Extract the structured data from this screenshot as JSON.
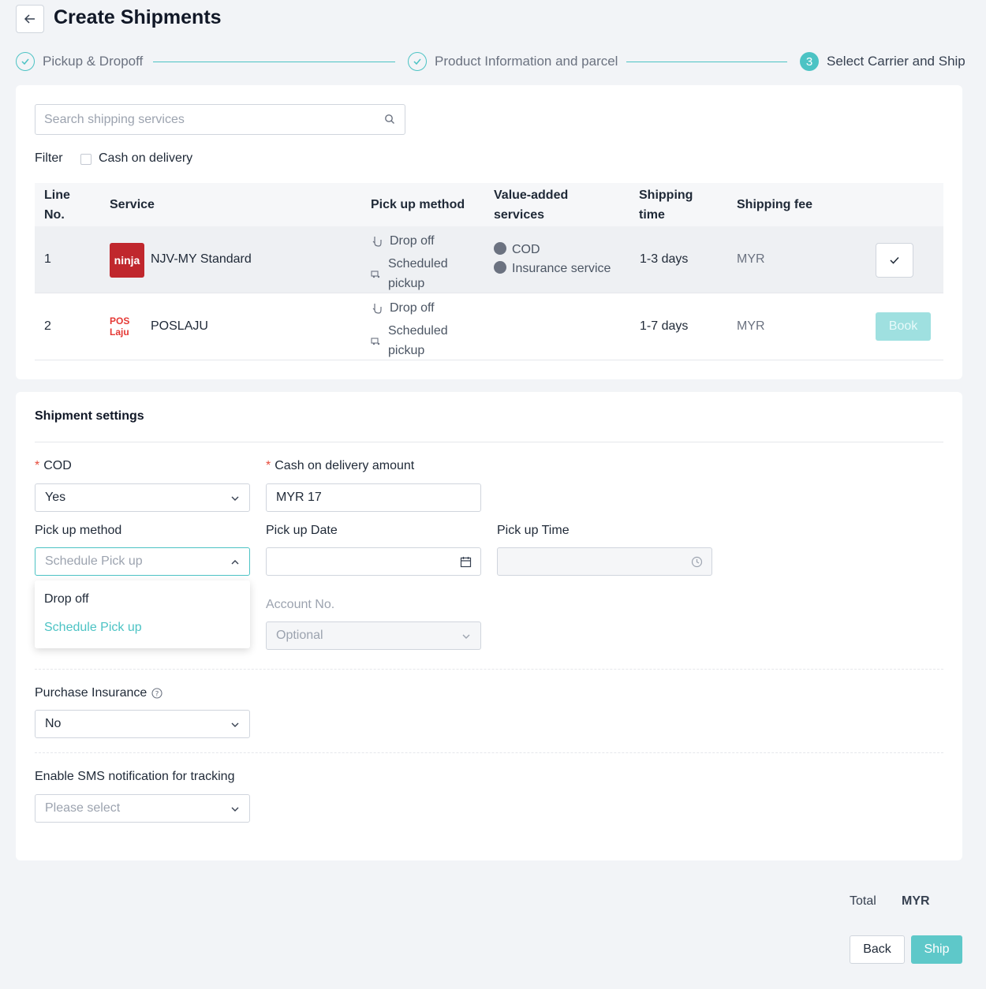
{
  "header": {
    "title": "Create Shipments"
  },
  "steps": [
    {
      "label": "Pickup & Dropoff",
      "status": "done"
    },
    {
      "label": "Product Information and parcel",
      "status": "done"
    },
    {
      "number": "3",
      "label": "Select Carrier and Ship",
      "status": "active"
    }
  ],
  "carriers": {
    "search_placeholder": "Search shipping services",
    "filter_label": "Filter",
    "cod_filter_label": "Cash on delivery",
    "columns": {
      "line_no": "Line No.",
      "service": "Service",
      "pickup_method": "Pick up method",
      "value_added": "Value-added services",
      "shipping_time": "Shipping time",
      "shipping_fee": "Shipping fee"
    },
    "rows": [
      {
        "line": "1",
        "logo_text": "ninja",
        "service": "NJV-MY Standard",
        "pickup_1": "Drop off",
        "pickup_2": "Scheduled pickup",
        "vas_1": "COD",
        "vas_2": "Insurance service",
        "time": "1-3 days",
        "fee": "MYR",
        "selected": true
      },
      {
        "line": "2",
        "logo_text": "POS Laju",
        "service": "POSLAJU",
        "pickup_1": "Drop off",
        "pickup_2": "Scheduled pickup",
        "time": "1-7 days",
        "fee": "MYR",
        "action": "Book"
      }
    ]
  },
  "settings": {
    "title": "Shipment settings",
    "cod": {
      "label": "COD",
      "value": "Yes"
    },
    "cod_amount": {
      "label": "Cash on delivery amount",
      "value": "MYR 17"
    },
    "pickup_method": {
      "label": "Pick up method",
      "value": "Schedule Pick up",
      "options": [
        "Drop off",
        "Schedule Pick up"
      ]
    },
    "pickup_date": {
      "label": "Pick up Date"
    },
    "pickup_time": {
      "label": "Pick up Time"
    },
    "account_no": {
      "label": "Account No.",
      "placeholder": "Optional"
    },
    "insurance": {
      "label": "Purchase Insurance",
      "value": "No"
    },
    "sms": {
      "label": "Enable SMS notification for tracking",
      "placeholder": "Please select"
    }
  },
  "footer": {
    "total_label": "Total",
    "total_value": "MYR",
    "back_label": "Back",
    "ship_label": "Ship"
  },
  "colors": {
    "accent": "#4cc3c4",
    "required": "#e74c3c",
    "ninja_red": "#c0272d"
  }
}
